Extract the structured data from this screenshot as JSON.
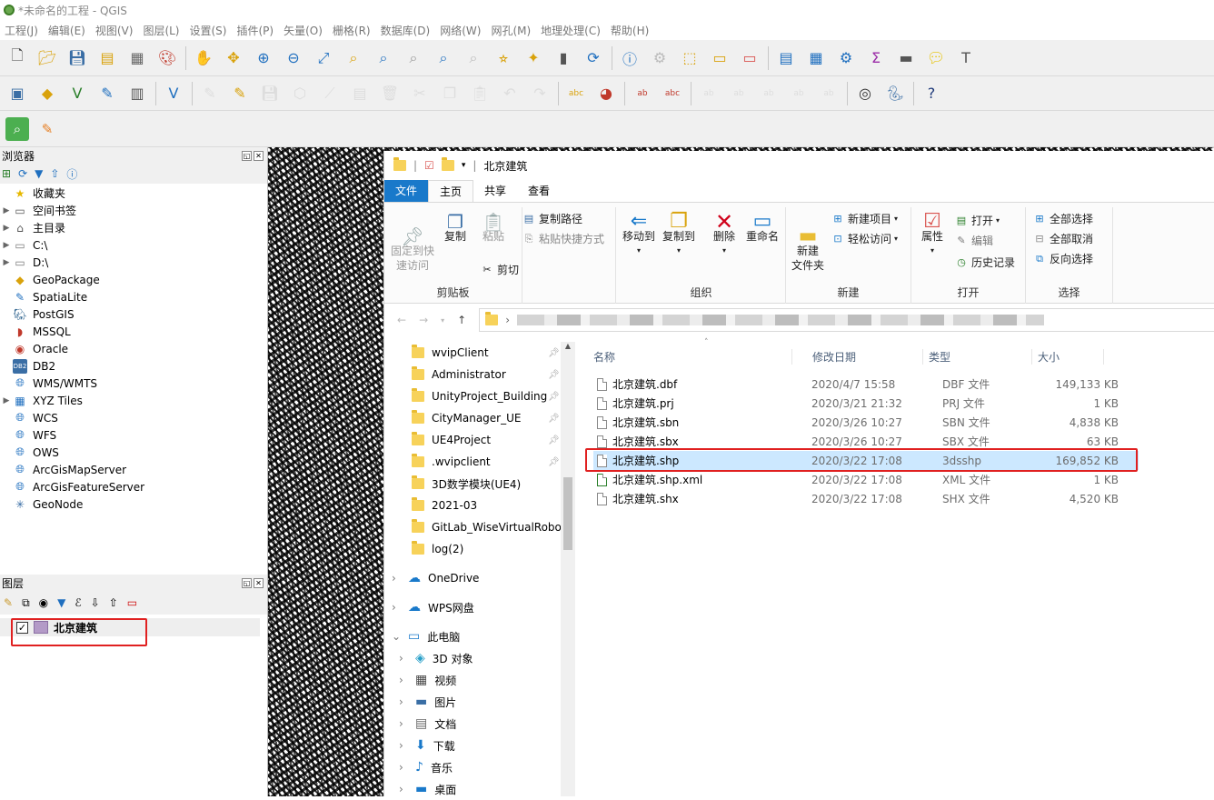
{
  "window": {
    "title": "*未命名的工程 - QGIS"
  },
  "menu": [
    "工程(J)",
    "编辑(E)",
    "视图(V)",
    "图层(L)",
    "设置(S)",
    "插件(P)",
    "矢量(O)",
    "栅格(R)",
    "数据库(D)",
    "网络(W)",
    "网孔(M)",
    "地理处理(C)",
    "帮助(H)"
  ],
  "browser": {
    "title": "浏览器",
    "items": [
      {
        "label": "收藏夹",
        "icon": "star-icon",
        "expand": false
      },
      {
        "label": "空间书签",
        "icon": "bookmark-icon",
        "expand": true
      },
      {
        "label": "主目录",
        "icon": "home-icon",
        "expand": true
      },
      {
        "label": "C:\\",
        "icon": "drive-icon",
        "expand": true
      },
      {
        "label": "D:\\",
        "icon": "drive-icon",
        "expand": true
      },
      {
        "label": "GeoPackage",
        "icon": "geopackage-icon",
        "expand": false
      },
      {
        "label": "SpatiaLite",
        "icon": "spatialite-icon",
        "expand": false
      },
      {
        "label": "PostGIS",
        "icon": "postgis-icon",
        "expand": false
      },
      {
        "label": "MSSQL",
        "icon": "mssql-icon",
        "expand": false
      },
      {
        "label": "Oracle",
        "icon": "oracle-icon",
        "expand": false
      },
      {
        "label": "DB2",
        "icon": "db2-icon",
        "expand": false
      },
      {
        "label": "WMS/WMTS",
        "icon": "globe-icon",
        "expand": false
      },
      {
        "label": "XYZ Tiles",
        "icon": "xyz-tiles-icon",
        "expand": true
      },
      {
        "label": "WCS",
        "icon": "globe-icon",
        "expand": false
      },
      {
        "label": "WFS",
        "icon": "globe-icon",
        "expand": false
      },
      {
        "label": "OWS",
        "icon": "globe-icon",
        "expand": false
      },
      {
        "label": "ArcGisMapServer",
        "icon": "globe-icon",
        "expand": false
      },
      {
        "label": "ArcGisFeatureServer",
        "icon": "globe-icon",
        "expand": false
      },
      {
        "label": "GeoNode",
        "icon": "geonode-icon",
        "expand": false
      }
    ]
  },
  "layers": {
    "title": "图层",
    "items": [
      {
        "label": "北京建筑",
        "checked": true,
        "color": "#b39ac7"
      }
    ]
  },
  "explorer": {
    "title": "北京建筑",
    "tabs": [
      "文件",
      "主页",
      "共享",
      "查看"
    ],
    "active_tab": "主页",
    "ribbon": {
      "pin": "固定到快\n速访问",
      "copy": "复制",
      "paste": "粘贴",
      "copy_path": "复制路径",
      "paste_shortcut": "粘贴快捷方式",
      "cut": "剪切",
      "clipboard": "剪贴板",
      "move_to": "移动到",
      "copy_to": "复制到",
      "delete": "删除",
      "rename": "重命名",
      "organize": "组织",
      "new_folder": "新建\n文件夹",
      "new_item": "新建项目",
      "easy_access": "轻松访问",
      "new": "新建",
      "properties": "属性",
      "open": "打开",
      "edit": "编辑",
      "history": "历史记录",
      "open_group": "打开",
      "select_all": "全部选择",
      "select_none": "全部取消",
      "invert": "反向选择",
      "select_group": "选择"
    },
    "nav_tree": [
      {
        "label": "wvipClient",
        "pinned": true
      },
      {
        "label": "Administrator",
        "pinned": true
      },
      {
        "label": "UnityProject_Building",
        "pinned": true
      },
      {
        "label": "CityManager_UE",
        "pinned": true
      },
      {
        "label": "UE4Project",
        "pinned": true
      },
      {
        "label": ".wvipclient",
        "pinned": true
      },
      {
        "label": "3D数学模块(UE4)",
        "pinned": false
      },
      {
        "label": "2021-03",
        "pinned": false
      },
      {
        "label": "GitLab_WiseVirtualRobot",
        "pinned": false
      },
      {
        "label": "log(2)",
        "pinned": false
      }
    ],
    "nav_roots": [
      {
        "label": "OneDrive",
        "icon": "cloud-icon"
      },
      {
        "label": "WPS网盘",
        "icon": "wps-cloud-icon"
      },
      {
        "label": "此电脑",
        "icon": "computer-icon"
      }
    ],
    "nav_pc": [
      {
        "label": "3D 对象",
        "icon": "3d-objects-icon"
      },
      {
        "label": "视频",
        "icon": "video-icon"
      },
      {
        "label": "图片",
        "icon": "pictures-icon"
      },
      {
        "label": "文档",
        "icon": "documents-icon"
      },
      {
        "label": "下载",
        "icon": "download-icon"
      },
      {
        "label": "音乐",
        "icon": "music-icon"
      },
      {
        "label": "桌面",
        "icon": "desktop-icon"
      }
    ],
    "columns": [
      "名称",
      "修改日期",
      "类型",
      "大小"
    ],
    "files": [
      {
        "name": "北京建筑.dbf",
        "date": "2020/4/7 15:58",
        "type": "DBF 文件",
        "size": "149,133 KB",
        "selected": false
      },
      {
        "name": "北京建筑.prj",
        "date": "2020/3/21 21:32",
        "type": "PRJ 文件",
        "size": "1 KB",
        "selected": false
      },
      {
        "name": "北京建筑.sbn",
        "date": "2020/3/26 10:27",
        "type": "SBN 文件",
        "size": "4,838 KB",
        "selected": false
      },
      {
        "name": "北京建筑.sbx",
        "date": "2020/3/26 10:27",
        "type": "SBX 文件",
        "size": "63 KB",
        "selected": false
      },
      {
        "name": "北京建筑.shp",
        "date": "2020/3/22 17:08",
        "type": "3dsshp",
        "size": "169,852 KB",
        "selected": true
      },
      {
        "name": "北京建筑.shp.xml",
        "date": "2020/3/22 17:08",
        "type": "XML 文件",
        "size": "1 KB",
        "selected": false
      },
      {
        "name": "北京建筑.shx",
        "date": "2020/3/22 17:08",
        "type": "SHX 文件",
        "size": "4,520 KB",
        "selected": false
      }
    ]
  },
  "colors": {
    "accent": "#1979ca",
    "highlight": "#cce8ff",
    "annotation": "#e02020"
  }
}
